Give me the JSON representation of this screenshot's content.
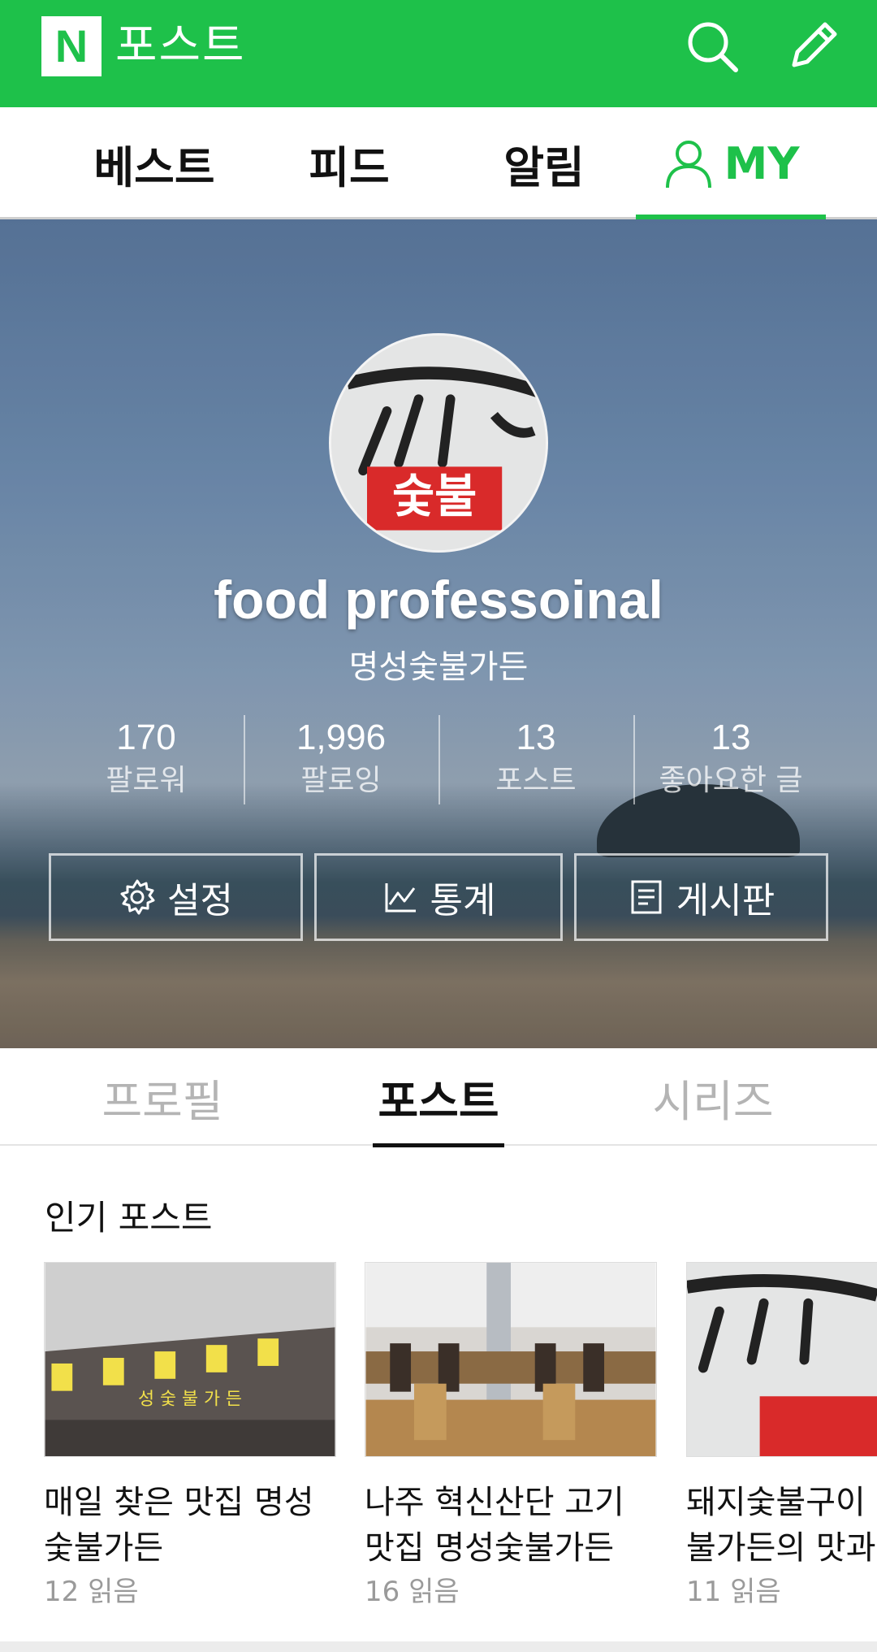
{
  "appbar": {
    "logo_letter": "N",
    "title": "포스트",
    "search_icon": "search-icon",
    "write_icon": "pencil-icon",
    "color": "#1ec14a"
  },
  "nav": {
    "tabs": [
      {
        "label": "베스트",
        "active": false
      },
      {
        "label": "피드",
        "active": false
      },
      {
        "label": "알림",
        "active": false
      },
      {
        "label": "MY",
        "active": true,
        "icon": "user-icon"
      }
    ]
  },
  "profile": {
    "avatar_text": "숯불",
    "name": "food professoinal",
    "subtitle": "명성숯불가든",
    "stats": [
      {
        "value": "170",
        "label": "팔로워"
      },
      {
        "value": "1,996",
        "label": "팔로잉"
      },
      {
        "value": "13",
        "label": "포스트"
      },
      {
        "value": "13",
        "label": "좋아요한 글"
      }
    ],
    "buttons": [
      {
        "label": "설정",
        "icon": "gear-icon"
      },
      {
        "label": "통계",
        "icon": "chart-icon"
      },
      {
        "label": "게시판",
        "icon": "document-icon"
      }
    ]
  },
  "subtabs": [
    {
      "label": "프로필",
      "active": false
    },
    {
      "label": "포스트",
      "active": true
    },
    {
      "label": "시리즈",
      "active": false
    }
  ],
  "popular": {
    "title": "인기 포스트",
    "sign_text": "성 숯 불 가 든",
    "cards": [
      {
        "title": "매일 찾은 맛집 명성\n숯불가든",
        "reads": "12 읽음"
      },
      {
        "title": "나주 혁신산단 고기\n맛집 명성숯불가든",
        "reads": "16 읽음"
      },
      {
        "title": "돼지숯불구이\n불가든의 맛과",
        "reads": "11 읽음"
      }
    ]
  }
}
